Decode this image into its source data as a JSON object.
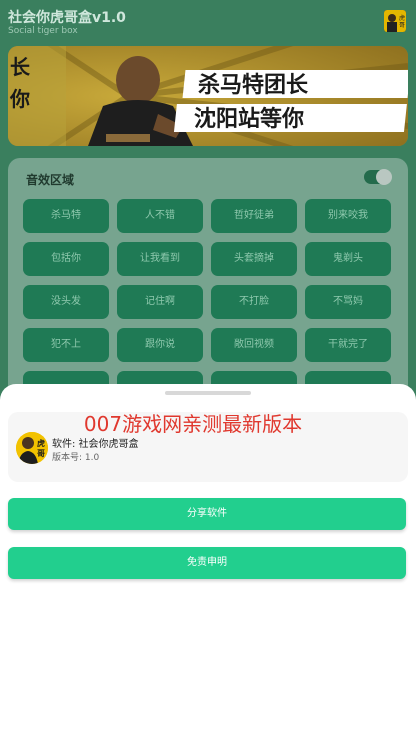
{
  "app": {
    "title": "社会你虎哥盒v1.0",
    "subtitle": "Social tiger box"
  },
  "banner": {
    "line1": "杀马特团长",
    "line2": "沈阳站等你",
    "left1": "长",
    "left2": "你"
  },
  "sound_section": {
    "label": "音效区域",
    "toggle_on": true,
    "buttons": [
      "杀马特",
      "人不错",
      "哲好徒弟",
      "别来咬我",
      "包括你",
      "让我看到",
      "头套摘掉",
      "鬼剃头",
      "没头发",
      "记住啊",
      "不打脸",
      "不骂妈",
      "犯不上",
      "跟你说",
      "敞回视频",
      "干就完了",
      "",
      "",
      "",
      ""
    ]
  },
  "sheet": {
    "watermark": "007游戏网亲测最新版本",
    "app_name": "软件: 社会你虎哥盒",
    "app_version": "版本号: 1.0",
    "share_label": "分享软件",
    "disclaimer_label": "免责申明",
    "accent": "#22cf8e"
  },
  "colors": {
    "primary_dim": "#3a7f5e",
    "button_dim": "#1f7a55",
    "watermark": "#e0382e"
  },
  "icons": {
    "top_right": "avatar-icon",
    "app_icon": "app-logo-icon"
  }
}
